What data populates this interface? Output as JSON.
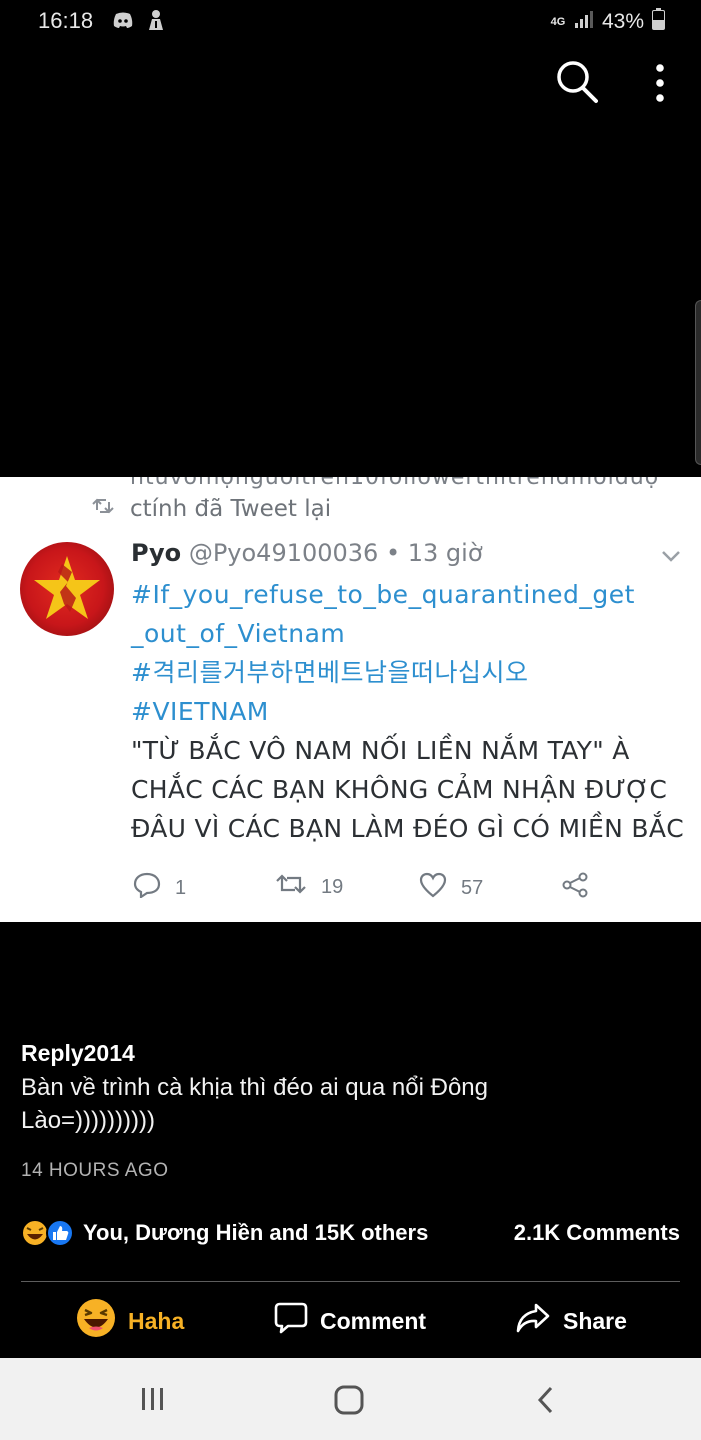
{
  "status_bar": {
    "time": "16:18",
    "network": "4G",
    "battery": "43%"
  },
  "tweet": {
    "cut_text": "ntuvomọngươitrên10followerthìtrendmoiđượ",
    "retweet_text": "ctính đã Tweet lại",
    "name": "Pyo",
    "meta": "@Pyo49100036 • 13 giờ",
    "lines": [
      {
        "text": "#If_you_refuse_to_be_quarantined_get",
        "kind": "tag"
      },
      {
        "text": "_out_of_Vietnam",
        "kind": "tag"
      },
      {
        "text": "#격리를거부하면베트남을떠나십시오",
        "kind": "tag"
      },
      {
        "text": "#VIETNAM",
        "kind": "tag"
      },
      {
        "text": "\"TỪ BẮC VÔ NAM NỐI LIỀN NẮM TAY\" À",
        "kind": "caps"
      },
      {
        "text": "CHẮC CÁC BẠN KHÔNG CẢM NHẬN ĐƯỢC",
        "kind": "caps"
      },
      {
        "text": "ĐÂU VÌ CÁC BẠN LÀM ĐÉO GÌ CÓ MIỀN BẮC",
        "kind": "caps"
      }
    ],
    "reply_count": "1",
    "retweet_count": "19",
    "like_count": "57"
  },
  "post": {
    "author": "Reply2014",
    "text": "Bàn về trình cà khịa thì đéo ai qua nổi Đông Lào=))))))))))",
    "time": "14 HOURS AGO",
    "reaction_summary": "You, Dương Hiền and 15K others",
    "comments_count": "2.1K Comments"
  },
  "actions": {
    "haha_label": "Haha",
    "comment_label": "Comment",
    "share_label": "Share"
  },
  "icons": {
    "top": [
      "search-icon",
      "more-vertical-icon"
    ],
    "nav": [
      "recent-apps-icon",
      "home-icon",
      "back-icon"
    ]
  },
  "colors": {
    "haha": "#f7b125",
    "hashtag": "#2d8fcf",
    "like_blue": "#1877f2"
  }
}
